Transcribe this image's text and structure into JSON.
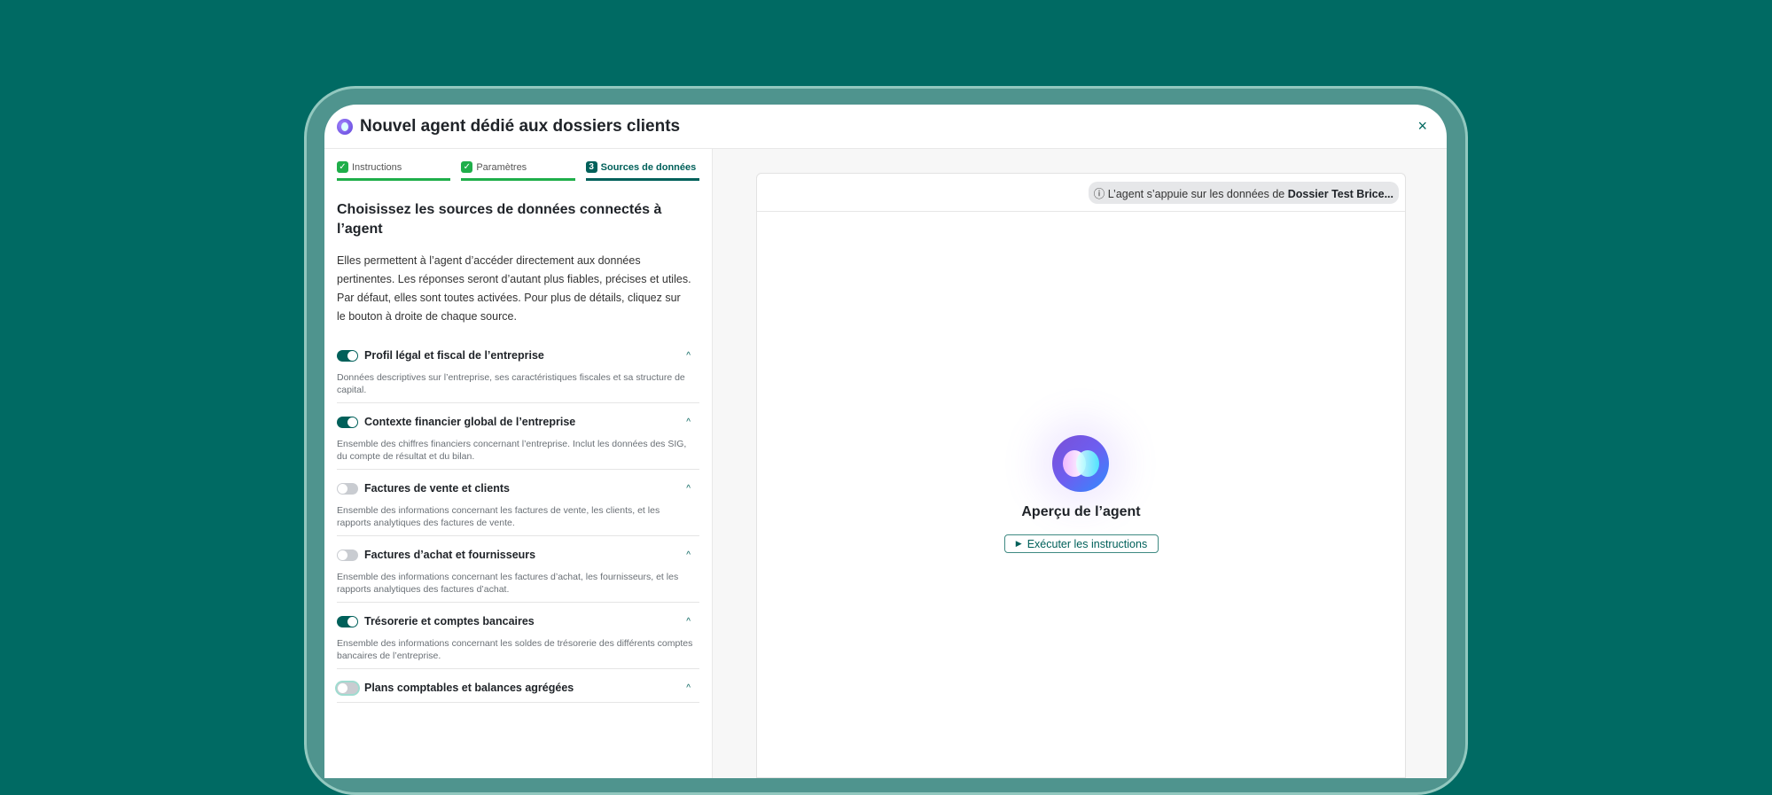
{
  "modal": {
    "title": "Nouvel agent dédié aux dossiers clients",
    "close_icon": "×"
  },
  "steps": [
    {
      "label": "Instructions",
      "state": "done"
    },
    {
      "label": "Paramètres",
      "state": "done"
    },
    {
      "label": "Sources de données",
      "number": "3",
      "state": "active"
    }
  ],
  "heading": "Choisissez les sources de données connectés à l’agent",
  "intro": "Elles permettent à l’agent d’accéder directement aux données pertinentes. Les réponses seront d’autant plus fiables, précises et utiles. Par défaut, elles sont toutes activées. Pour plus de détails, cliquez sur le bouton à droite de chaque source.",
  "sources": [
    {
      "name": "Profil légal et fiscal de l’entreprise",
      "enabled": true,
      "description": "Données descriptives sur l’entreprise, ses caractéristiques fiscales et sa structure de capital."
    },
    {
      "name": "Contexte financier global de l’entreprise",
      "enabled": true,
      "description": "Ensemble des chiffres financiers concernant l’entreprise. Inclut les données des SIG, du compte de résultat et du bilan."
    },
    {
      "name": "Factures de vente et clients",
      "enabled": false,
      "description": "Ensemble des informations concernant les factures de vente, les clients, et les rapports analytiques des factures de vente."
    },
    {
      "name": "Factures d’achat et fournisseurs",
      "enabled": false,
      "description": "Ensemble des informations concernant les factures d’achat, les fournisseurs, et les rapports analytiques des factures d’achat."
    },
    {
      "name": "Trésorerie et comptes bancaires",
      "enabled": true,
      "description": "Ensemble des informations concernant les soldes de trésorerie des différents comptes bancaires de l’entreprise."
    },
    {
      "name": "Plans comptables et balances agrégées",
      "enabled": false,
      "description": ""
    }
  ],
  "preview": {
    "info_prefix": "L’agent s’appuie sur les données de ",
    "info_dossier": "Dossier Test Brice...",
    "title": "Aperçu de l’agent",
    "run_label": "Exécuter les instructions"
  }
}
